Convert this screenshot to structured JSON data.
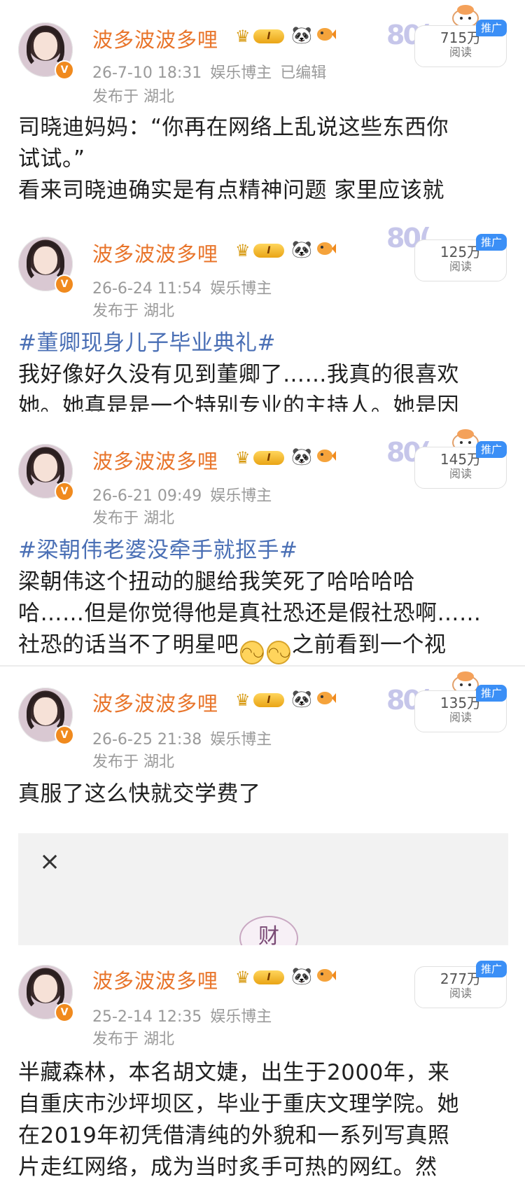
{
  "posts": [
    {
      "username": "波多波波多哩",
      "level": "I",
      "time": "26-7-10 18:31",
      "category": "娱乐博主",
      "edited": "已编辑",
      "location": "发布于 湖北",
      "reads": "715万",
      "reads_label": "阅读",
      "ad_tag": "推广",
      "deco": "80(",
      "lines": [
        "司晓迪妈妈：“你再在网络上乱说这些东西你",
        "试试。”",
        "看来司晓迪确实是有点精神问题 家里应该就"
      ]
    },
    {
      "username": "波多波波多哩",
      "level": "I",
      "time": "26-6-24 11:54",
      "category": "娱乐博主",
      "location": "发布于 湖北",
      "reads": "125万",
      "reads_label": "阅读",
      "ad_tag": "推广",
      "deco": "80(",
      "hashtag": "#董卿现身儿子毕业典礼#",
      "lines": [
        "我好像好久没有见到董卿了……我真的很喜欢",
        "她。她真是是一个特别专业的主持人。她是因"
      ]
    },
    {
      "username": "波多波波多哩",
      "level": "I",
      "time": "26-6-21 09:49",
      "category": "娱乐博主",
      "location": "发布于 湖北",
      "reads": "145万",
      "reads_label": "阅读",
      "ad_tag": "推广",
      "deco": "80(",
      "hashtag": "#梁朝伟老婆没牵手就抠手#",
      "lines": [
        "梁朝伟这个扭动的腿给我笑死了哈哈哈哈",
        "哈……但是你觉得他是真社恐还是假社恐啊……"
      ],
      "line3a": "社恐的话当不了明星吧",
      "line3b": "之前看到一个视"
    },
    {
      "username": "波多波波多哩",
      "level": "I",
      "time": "26-6-25 21:38",
      "category": "娱乐博主",
      "location": "发布于 湖北",
      "reads": "135万",
      "reads_label": "阅读",
      "ad_tag": "推广",
      "deco": "80(",
      "lines": [
        "真服了这么快就交学费了"
      ],
      "ad_close": "×",
      "ad_logo": "财"
    },
    {
      "username": "波多波波多哩",
      "level": "I",
      "time": "25-2-14 12:35",
      "category": "娱乐博主",
      "location": "发布于 湖北",
      "reads": "277万",
      "reads_label": "阅读",
      "ad_tag": "推广",
      "lines": [
        "半藏森林，本名胡文婕，出生于2000年，来",
        "自重庆市沙坪坝区，毕业于重庆文理学院。她",
        "在2019年初凭借清纯的外貌和一系列写真照",
        "片走红网络，成为当时炙手可热的网红。然"
      ]
    }
  ]
}
